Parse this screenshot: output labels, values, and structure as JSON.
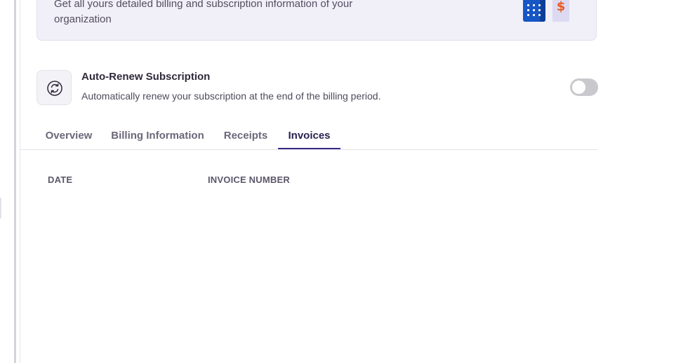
{
  "banner": {
    "description": "Get all yours detailed billing and subscription information of your organization",
    "illustration_icons": [
      "building-icon",
      "dollar-note-icon"
    ],
    "dollar_symbol": "$"
  },
  "auto_renew": {
    "icon": "refresh-icon",
    "title": "Auto-Renew Subscription",
    "description": "Automatically renew your subscription at the end of the billing period.",
    "enabled": false
  },
  "tabs": [
    {
      "label": "Overview",
      "active": false
    },
    {
      "label": "Billing Information",
      "active": false
    },
    {
      "label": "Receipts",
      "active": false
    },
    {
      "label": "Invoices",
      "active": true
    }
  ],
  "invoices_table": {
    "columns": [
      "DATE",
      "INVOICE NUMBER"
    ],
    "rows": []
  },
  "colors": {
    "accent": "#3a2a86",
    "banner_bg": "#f1eff7",
    "building_blue": "#1656c5",
    "dollar_orange": "#ea5a1e"
  }
}
